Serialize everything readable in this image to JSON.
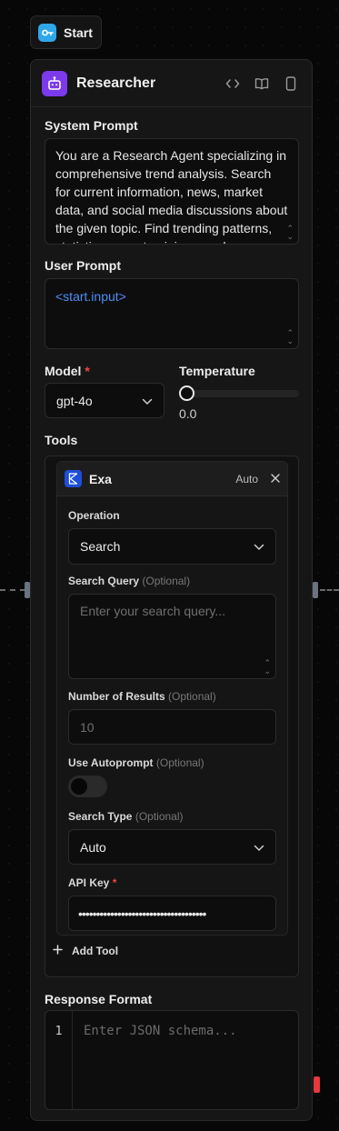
{
  "start_node": {
    "label": "Start"
  },
  "agent_block": {
    "title": "Researcher",
    "system_prompt": {
      "label": "System Prompt",
      "value": "You are a Research Agent specializing in comprehensive trend analysis. Search for current information, news, market data, and social media discussions about the given topic. Find trending patterns, statistics, expert opinions, and"
    },
    "user_prompt": {
      "label": "User Prompt",
      "value": "<start.input>"
    },
    "model": {
      "label": "Model",
      "required_mark": "*",
      "selected": "gpt-4o"
    },
    "temperature": {
      "label": "Temperature",
      "value": "0.0",
      "level": 0
    },
    "tools": {
      "label": "Tools",
      "items": [
        {
          "name": "Exa",
          "mode": "Auto",
          "operation": {
            "label": "Operation",
            "selected": "Search"
          },
          "search_query": {
            "label": "Search Query",
            "optional": "(Optional)",
            "placeholder": "Enter your search query..."
          },
          "num_results": {
            "label": "Number of Results",
            "optional": "(Optional)",
            "placeholder": "10"
          },
          "use_autoprompt": {
            "label": "Use Autoprompt",
            "optional": "(Optional)",
            "enabled": false
          },
          "search_type": {
            "label": "Search Type",
            "optional": "(Optional)",
            "selected": "Auto"
          },
          "api_key": {
            "label": "API Key",
            "required_mark": "*",
            "masked_value": "••••••••••••••••••••••••••••••••••••"
          }
        }
      ],
      "add_label": "Add Tool"
    },
    "response_format": {
      "label": "Response Format",
      "line_number": "1",
      "placeholder": "Enter JSON schema..."
    }
  },
  "colors": {
    "background": "#070707",
    "block": "#161616",
    "accent_purple": "#7c3aed",
    "start_blue": "#2fa7ea",
    "exa_blue": "#1f4fd8",
    "link_blue": "#4f8df7",
    "required_red": "#ef4444"
  }
}
